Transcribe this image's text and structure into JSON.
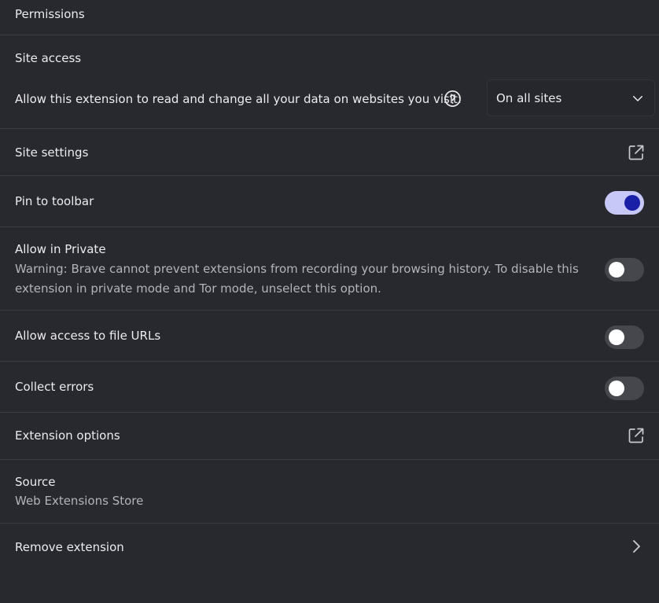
{
  "permissions": {
    "label": "Permissions"
  },
  "site_access": {
    "heading": "Site access",
    "description": "Allow this extension to read and change all your data on websites you visit:",
    "help_icon": "help-circle-icon",
    "dropdown": {
      "selected": "On all sites",
      "icon": "chevron-down-icon"
    }
  },
  "site_settings": {
    "label": "Site settings",
    "icon": "open-external-icon"
  },
  "pin_to_toolbar": {
    "label": "Pin to toolbar",
    "enabled": true
  },
  "allow_in_private": {
    "label": "Allow in Private",
    "warning_line1": "Warning: Brave cannot prevent extensions from recording your browsing history. To disable this",
    "warning_line2": "extension in private mode and Tor mode, unselect this option.",
    "enabled": false
  },
  "allow_file_urls": {
    "label": "Allow access to file URLs",
    "enabled": false
  },
  "collect_errors": {
    "label": "Collect errors",
    "enabled": false
  },
  "extension_options": {
    "label": "Extension options",
    "icon": "open-external-icon"
  },
  "source": {
    "label": "Source",
    "value": "Web Extensions Store"
  },
  "remove_extension": {
    "label": "Remove extension",
    "icon": "chevron-right-icon"
  },
  "colors": {
    "background": "#28292e",
    "divider": "#3b3c42",
    "toggle_on_track": "#c7c8f8",
    "toggle_on_knob": "#1a1fa8",
    "toggle_off_track": "#46474d"
  }
}
